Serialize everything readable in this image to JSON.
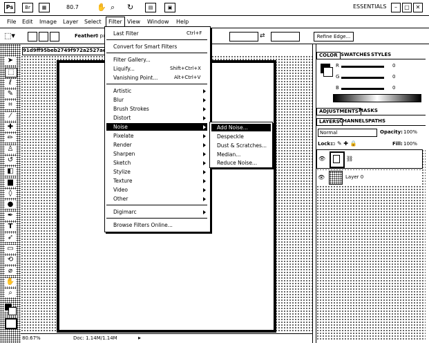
{
  "appbar": {
    "logo": "Ps",
    "zoom": "80.7",
    "workspace": "ESSENTIALS",
    "window_min": "–",
    "window_max": "□",
    "window_close": "✕"
  },
  "menubar": {
    "items": [
      "File",
      "Edit",
      "Image",
      "Layer",
      "Select",
      "Filter",
      "View",
      "Window",
      "Help"
    ],
    "active": "Filter"
  },
  "options": {
    "feather_label": "Feather:",
    "feather_value": "0 px",
    "refine_edge": "Refine Edge..."
  },
  "document": {
    "tab_title": "91d9ff95beb2749f972a2527ae12...",
    "zoom": "80.67%",
    "doc_info": "Doc: 1.14M/1.14M"
  },
  "filter_menu": {
    "items": [
      {
        "label": "Last Filter",
        "shortcut": "Ctrl+F"
      },
      {
        "label": "Convert for Smart Filters",
        "shortcut": ""
      },
      {
        "label": "Filter Gallery...",
        "shortcut": ""
      },
      {
        "label": "Liquify...",
        "shortcut": "Shift+Ctrl+X"
      },
      {
        "label": "Vanishing Point...",
        "shortcut": "Alt+Ctrl+V"
      },
      {
        "label": "Artistic",
        "shortcut": ""
      },
      {
        "label": "Blur",
        "shortcut": ""
      },
      {
        "label": "Brush Strokes",
        "shortcut": ""
      },
      {
        "label": "Distort",
        "shortcut": ""
      },
      {
        "label": "Noise",
        "shortcut": ""
      },
      {
        "label": "Pixelate",
        "shortcut": ""
      },
      {
        "label": "Render",
        "shortcut": ""
      },
      {
        "label": "Sharpen",
        "shortcut": ""
      },
      {
        "label": "Sketch",
        "shortcut": ""
      },
      {
        "label": "Stylize",
        "shortcut": ""
      },
      {
        "label": "Texture",
        "shortcut": ""
      },
      {
        "label": "Video",
        "shortcut": ""
      },
      {
        "label": "Other",
        "shortcut": ""
      },
      {
        "label": "Digimarc",
        "shortcut": ""
      },
      {
        "label": "Browse Filters Online...",
        "shortcut": ""
      }
    ]
  },
  "noise_submenu": {
    "items": [
      "Add Noise...",
      "Despeckle",
      "Dust & Scratches...",
      "Median...",
      "Reduce Noise..."
    ]
  },
  "color_panel": {
    "tabs": [
      "COLOR",
      "SWATCHES",
      "STYLES"
    ],
    "channels": [
      {
        "label": "R",
        "value": "0"
      },
      {
        "label": "G",
        "value": "0"
      },
      {
        "label": "B",
        "value": "0"
      }
    ]
  },
  "adjust_panel": {
    "tabs": [
      "ADJUSTMENTS",
      "MASKS"
    ]
  },
  "layers_panel": {
    "tabs": [
      "LAYERS",
      "CHANNELS",
      "PATHS"
    ],
    "blend_mode": "Normal",
    "opacity_label": "Opacity:",
    "opacity_value": "100%",
    "lock_label": "Lock:",
    "fill_label": "Fill:",
    "fill_value": "100%",
    "layers": [
      {
        "name": ""
      },
      {
        "name": "Layer 0"
      }
    ]
  }
}
